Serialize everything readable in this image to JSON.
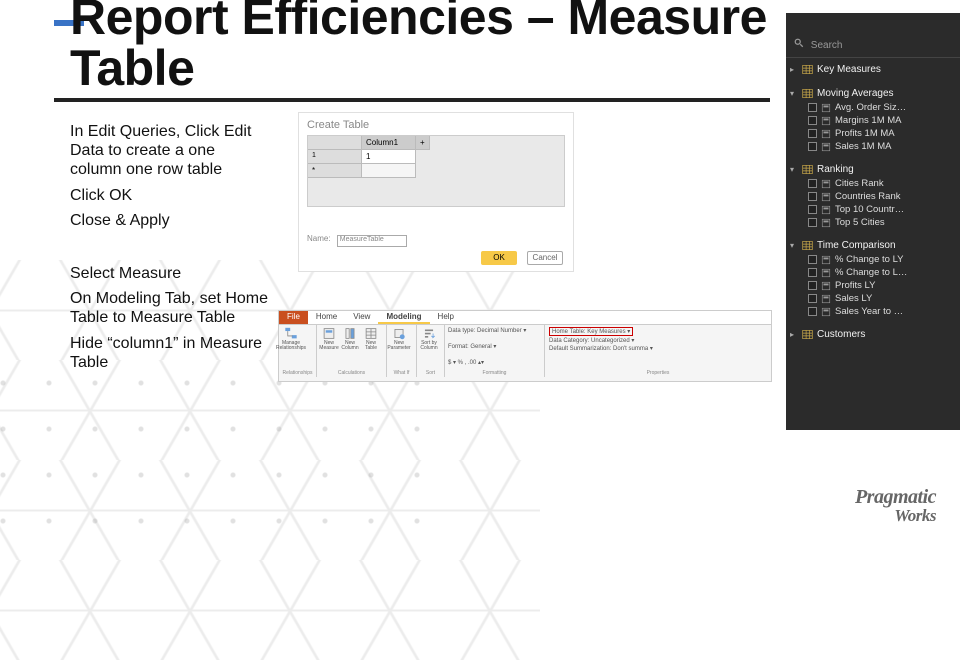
{
  "title_line1": "Report Efficiencies – Measure",
  "title_line2": "Table",
  "instructions": {
    "p1": "In Edit Queries, Click Edit Data to create a one column one row table",
    "p2": "Click OK",
    "p3": "Close & Apply",
    "p4": "Select Measure",
    "p5": "On Modeling Tab, set Home Table to Measure Table",
    "p6": "Hide “column1” in Measure Table"
  },
  "create_table": {
    "title": "Create Table",
    "col_header": "Column1",
    "row1_idx": "1",
    "row1_val": "1",
    "name_label": "Name:",
    "name_value": "MeasureTable",
    "ok": "OK",
    "cancel": "Cancel"
  },
  "ribbon": {
    "tabs": {
      "file": "File",
      "home": "Home",
      "view": "View",
      "modeling": "Modeling",
      "help": "Help"
    },
    "icons": {
      "manage": "Manage\nRelationships",
      "newmeasure": "New\nMeasure",
      "newcolumn": "New\nColumn",
      "newtable": "New\nTable",
      "newparam": "New\nParameter",
      "sortby": "Sort by\nColumn"
    },
    "props": {
      "datatype": "Data type: Decimal Number ▾",
      "format": "Format: General ▾",
      "symbols": "$ ▾  %  ,  .00  ▴▾",
      "hometable": "Home Table: Key Measures ▾",
      "datacategory": "Data Category: Uncategorized ▾",
      "summarization": "Default Summarization: Don't summa ▾"
    },
    "sections": {
      "rel": "Relationships",
      "calc": "Calculations",
      "whatif": "What If",
      "sort": "Sort",
      "fmt": "Formatting",
      "prop": "Properties"
    }
  },
  "fields": {
    "search": "Search",
    "groups": [
      {
        "name": "Key Measures",
        "expanded": false,
        "items": []
      },
      {
        "name": "Moving Averages",
        "expanded": true,
        "items": [
          "Avg. Order Siz…",
          "Margins 1M MA",
          "Profits 1M MA",
          "Sales 1M MA"
        ]
      },
      {
        "name": "Ranking",
        "expanded": true,
        "items": [
          "Cities Rank",
          "Countries Rank",
          "Top 10 Countr…",
          "Top 5 Cities"
        ]
      },
      {
        "name": "Time Comparison",
        "expanded": true,
        "items": [
          "% Change to LY",
          "% Change to L…",
          "Profits LY",
          "Sales LY",
          "Sales Year to …"
        ]
      },
      {
        "name": "Customers",
        "expanded": false,
        "items": []
      }
    ]
  },
  "logo": {
    "main": "Pragmatic",
    "sub": "Works"
  }
}
